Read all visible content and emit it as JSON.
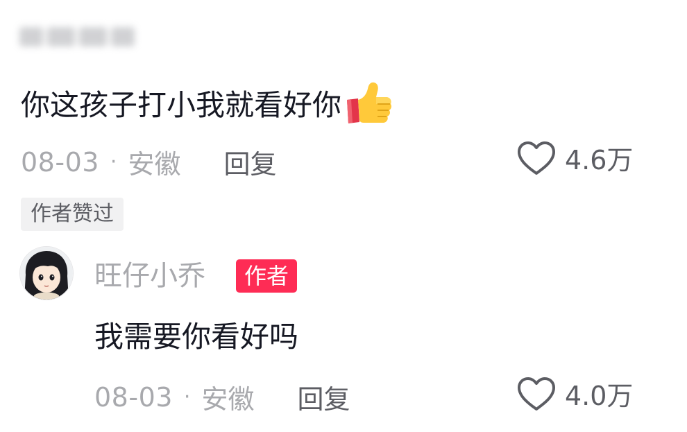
{
  "comment": {
    "text": "你这孩子打小我就看好你",
    "emoji": "thumbs-up-icon",
    "date": "08-03",
    "separator": "·",
    "location": "安徽",
    "reply_label": "回复",
    "like_count": "4.6万",
    "author_liked_label": "作者赞过"
  },
  "reply": {
    "author_name": "旺仔小乔",
    "author_badge": "作者",
    "text": "我需要你看好吗",
    "date": "08-03",
    "separator": "·",
    "location": "安徽",
    "reply_label": "回复",
    "like_count": "4.0万"
  },
  "colors": {
    "text_primary": "#161823",
    "text_secondary": "#a8a9ad",
    "action_gray": "#5c5d63",
    "author_badge_bg": "#fe2c55"
  }
}
